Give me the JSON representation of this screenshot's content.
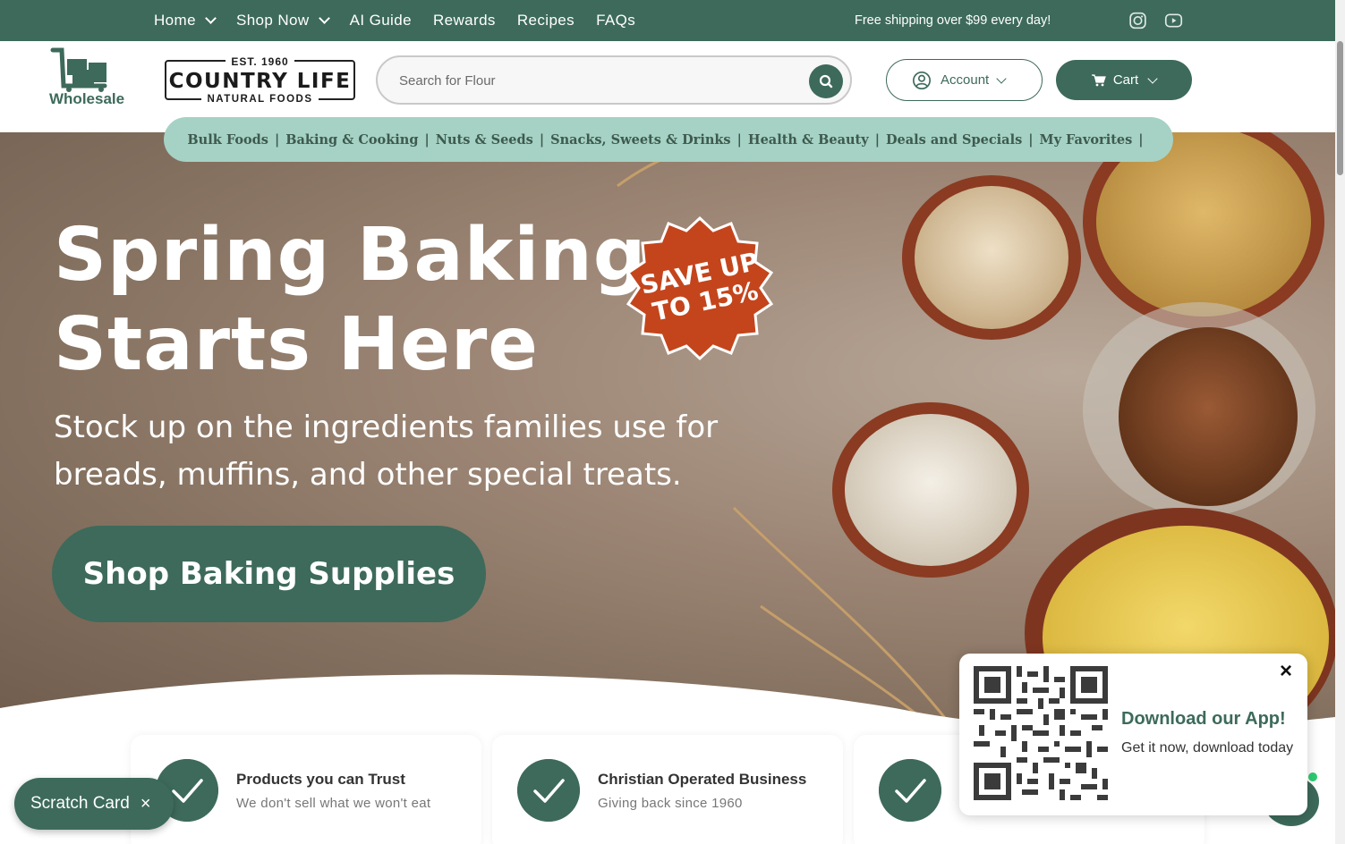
{
  "topbar": {
    "nav": [
      {
        "label": "Home",
        "dropdown": true
      },
      {
        "label": "Shop Now",
        "dropdown": true
      },
      {
        "label": "AI Guide",
        "dropdown": false
      },
      {
        "label": "Rewards",
        "dropdown": false
      },
      {
        "label": "Recipes",
        "dropdown": false
      },
      {
        "label": "FAQs",
        "dropdown": false
      }
    ],
    "promo": "Free shipping over $99 every day!",
    "social_icons": [
      "instagram-icon",
      "youtube-icon"
    ]
  },
  "header": {
    "wholesale_label": "Wholesale",
    "logo": {
      "est": "EST. 1960",
      "name": "COUNTRY LIFE",
      "sub": "NATURAL FOODS"
    },
    "search": {
      "placeholder": "Search for Flour",
      "value": ""
    },
    "account_label": "Account",
    "cart_label": "Cart"
  },
  "categories": [
    "Bulk Foods",
    "Baking & Cooking",
    "Nuts & Seeds",
    "Snacks, Sweets & Drinks",
    "Health & Beauty",
    "Deals and Specials",
    "My Favorites"
  ],
  "hero": {
    "title_line1": "Spring Baking",
    "title_line2": "Starts Here",
    "badge_line1": "SAVE UP",
    "badge_line2": "TO 15%",
    "subtitle": "Stock up on the ingredients families use for breads, muffins, and other special treats.",
    "cta": "Shop Baking Supplies"
  },
  "features": [
    {
      "title": "Products you can Trust",
      "subtitle": "We don't sell what we won't eat"
    },
    {
      "title": "Christian Operated Business",
      "subtitle": "Giving back since 1960"
    },
    {
      "title": "",
      "subtitle": ""
    }
  ],
  "scratch_card": {
    "label": "Scratch Card",
    "close": "×"
  },
  "app_popup": {
    "title": "Download our App!",
    "subtitle": "Get it now, download today",
    "close": "×"
  },
  "colors": {
    "primary": "#3d6a5b",
    "category_bar": "#a5d2c4",
    "badge": "#c4451c",
    "online": "#2ecc71"
  }
}
